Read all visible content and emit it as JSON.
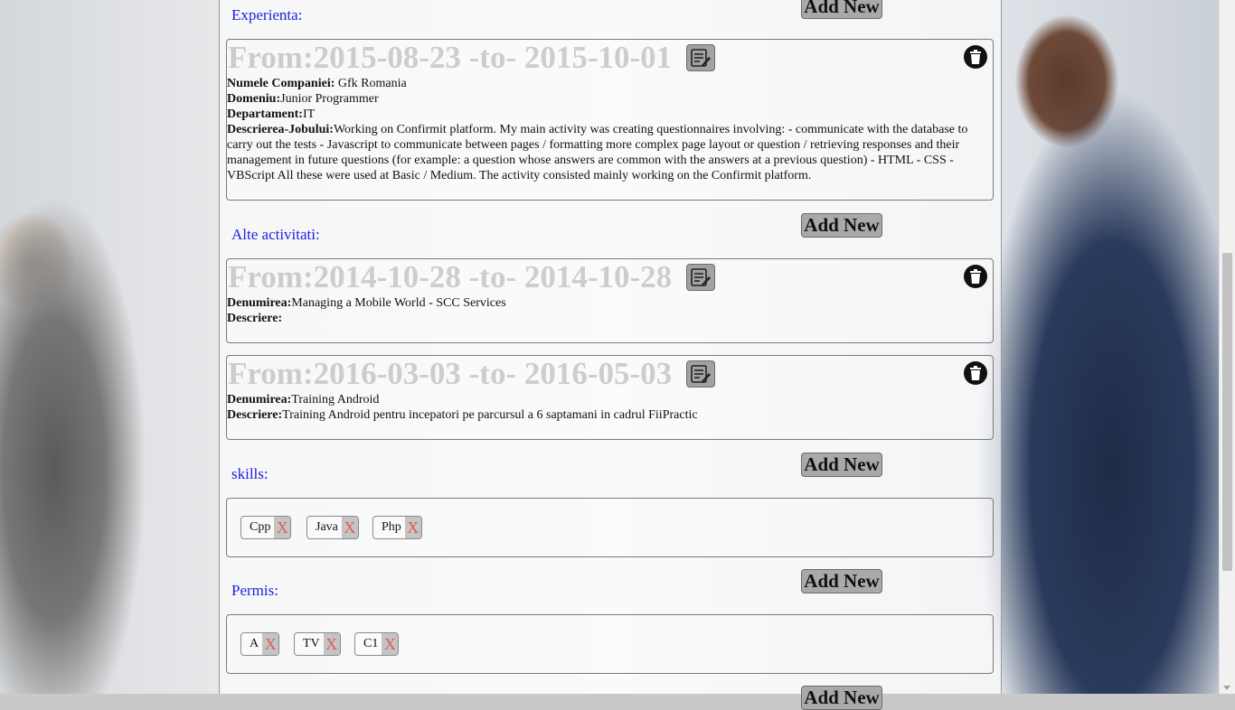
{
  "colors": {
    "section_title": "#2020e0",
    "delete_x": "#e15a5a",
    "button_bg": "#a9a9a9"
  },
  "add_new_label": "Add New",
  "experienta": {
    "title": "Experienta:",
    "entries": [
      {
        "heading": "From:2015-08-23 -to- 2015-10-01",
        "company_label": "Numele Companiei:",
        "company": " Gfk Romania",
        "domain_label": "Domeniu:",
        "domain": "Junior Programmer",
        "dept_label": "Departament:",
        "dept": "IT",
        "desc_label": "Descrierea-Jobului:",
        "desc": "Working on Confirmit platform. My main activity was creating questionnaires involving: - communicate with the database to carry out the tests - Javascript to communicate between pages / formatting more complex page layout or question / retrieving responses and their management in future questions (for example: a question whose answers are common with the answers at a previous question) - HTML - CSS - VBScript All these were used at Basic / Medium. The activity consisted mainly working on the Confirmit platform."
      }
    ]
  },
  "alte": {
    "title": "Alte activitati:",
    "entries": [
      {
        "heading": "From:2014-10-28 -to- 2014-10-28",
        "name_label": "Denumirea:",
        "name": "Managing a Mobile World - SCC Services",
        "desc_label": "Descriere:",
        "desc": ""
      },
      {
        "heading": "From:2016-03-03 -to- 2016-05-03",
        "name_label": "Denumirea:",
        "name": "Training Android",
        "desc_label": "Descriere:",
        "desc": "Training Android pentru incepatori pe parcursul a 6 saptamani in cadrul FiiPractic"
      }
    ]
  },
  "skills": {
    "title": "skills:",
    "tags": [
      "Cpp",
      "Java",
      "Php"
    ]
  },
  "permis": {
    "title": "Permis:",
    "tags": [
      "A",
      "TV",
      "C1"
    ]
  },
  "remove_label": "X"
}
